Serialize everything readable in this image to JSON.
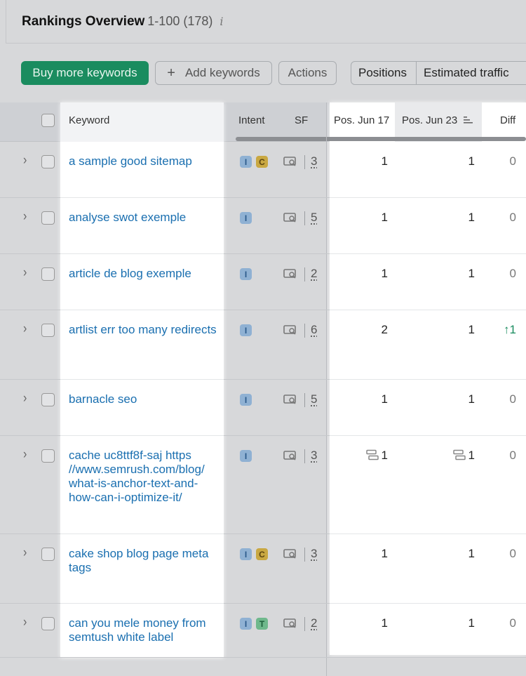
{
  "header": {
    "title": "Rankings Overview",
    "range": "1-100 (178)",
    "info_icon": "i"
  },
  "toolbar": {
    "buy_label": "Buy more keywords",
    "add_label": "Add keywords",
    "add_icon": "+",
    "actions_label": "Actions",
    "segments": [
      "Positions",
      "Estimated traffic"
    ]
  },
  "table": {
    "columns": {
      "keyword": "Keyword",
      "intent": "Intent",
      "sf": "SF",
      "pos1": "Pos. Jun 17",
      "pos2": "Pos. Jun 23",
      "diff": "Diff"
    },
    "rows": [
      {
        "keyword": "a sample good sitemap",
        "intents": [
          "I",
          "C"
        ],
        "sf": "3",
        "pos1": "1",
        "pos2": "1",
        "diff": "0"
      },
      {
        "keyword": "analyse swot exemple",
        "intents": [
          "I"
        ],
        "sf": "5",
        "pos1": "1",
        "pos2": "1",
        "diff": "0"
      },
      {
        "keyword": "article de blog exemple",
        "intents": [
          "I"
        ],
        "sf": "2",
        "pos1": "1",
        "pos2": "1",
        "diff": "0"
      },
      {
        "keyword": "artlist err too many redirects",
        "intents": [
          "I"
        ],
        "sf": "6",
        "pos1": "2",
        "pos2": "1",
        "diff": "↑1"
      },
      {
        "keyword": "barnacle seo",
        "intents": [
          "I"
        ],
        "sf": "5",
        "pos1": "1",
        "pos2": "1",
        "diff": "0"
      },
      {
        "keyword": "cache uc8ttf8f-saj https //www.semrush.com/blog/ what-is-anchor-text-and-how-can-i-optimize-it/",
        "intents": [
          "I"
        ],
        "sf": "3",
        "pos1": "1",
        "pos2": "1",
        "diff": "0"
      },
      {
        "keyword": "cake shop blog page meta tags",
        "intents": [
          "I",
          "C"
        ],
        "sf": "3",
        "pos1": "1",
        "pos2": "1",
        "diff": "0"
      },
      {
        "keyword": "can you mele money from semtush white label",
        "intents": [
          "I",
          "T"
        ],
        "sf": "2",
        "pos1": "1",
        "pos2": "1",
        "diff": "0"
      }
    ]
  },
  "colors": {
    "brand_green": "#1a8c5f",
    "link_blue": "#1a6fb0",
    "intent_I": "#8fb1d3",
    "intent_C": "#c9a842",
    "intent_T": "#6fb88c"
  }
}
